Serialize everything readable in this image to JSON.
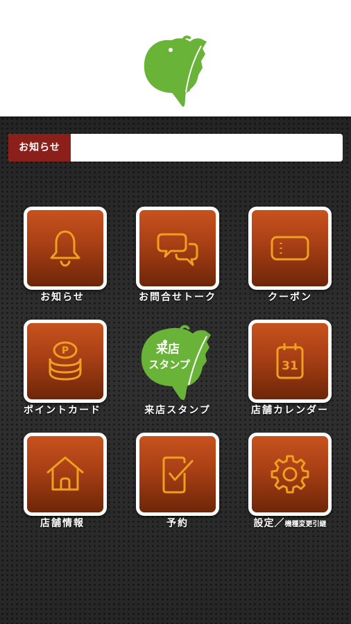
{
  "notice_bar": {
    "tag": "お知らせ",
    "text": ""
  },
  "menu": {
    "row1": [
      {
        "label": "お知らせ",
        "icon": "bell-icon"
      },
      {
        "label": "お問合せトーク",
        "icon": "chat-bubbles-icon"
      },
      {
        "label": "クーポン",
        "icon": "coupon-icon"
      }
    ],
    "row2": [
      {
        "label": "ポイントカード",
        "icon": "point-coins-icon"
      },
      {
        "label": "来店スタンプ",
        "icon": "stamp-fish-icon",
        "badge_line1": "来店",
        "badge_line2": "スタンプ"
      },
      {
        "label": "店舗カレンダー",
        "icon": "calendar-icon",
        "calendar_day": "31"
      }
    ],
    "row3": [
      {
        "label": "店舗情報",
        "icon": "home-icon"
      },
      {
        "label": "予約",
        "icon": "reservation-check-icon"
      },
      {
        "label_main": "設定／",
        "label_small": "機種変更引継",
        "icon": "gear-icon"
      }
    ]
  },
  "colors": {
    "accent_orange": "#f0a020",
    "tile_top": "#c8521e",
    "tile_bottom": "#6e2608",
    "notice_tag_bg": "#8b1f1a",
    "logo_green": "#69b338"
  }
}
